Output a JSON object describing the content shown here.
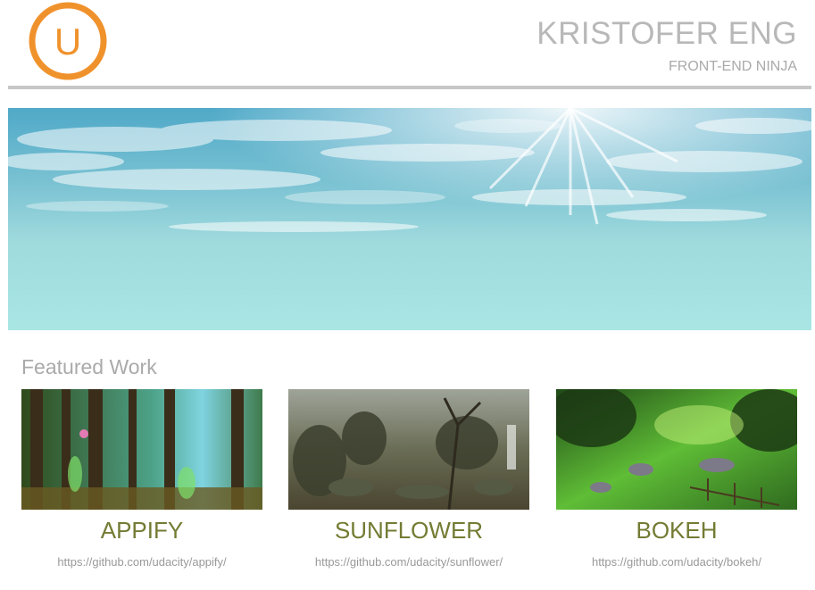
{
  "header": {
    "logo_letter": "U",
    "name": "KRISTOFER ENG",
    "subtitle": "FRONT-END NINJA"
  },
  "hero": {
    "description_icon": "sky-image"
  },
  "featured": {
    "heading": "Featured Work",
    "projects": [
      {
        "title": "APPIFY",
        "url": "https://github.com/udacity/appify/",
        "image": "forest-painting"
      },
      {
        "title": "SUNFLOWER",
        "url": "https://github.com/udacity/sunflower/",
        "image": "swamp-painting"
      },
      {
        "title": "BOKEH",
        "url": "https://github.com/udacity/bokeh/",
        "image": "green-valley-painting"
      }
    ]
  },
  "colors": {
    "accent": "#f0922c",
    "title_olive": "#747b33",
    "muted_text": "#aaaaaa",
    "divider": "#c7c7c7"
  }
}
